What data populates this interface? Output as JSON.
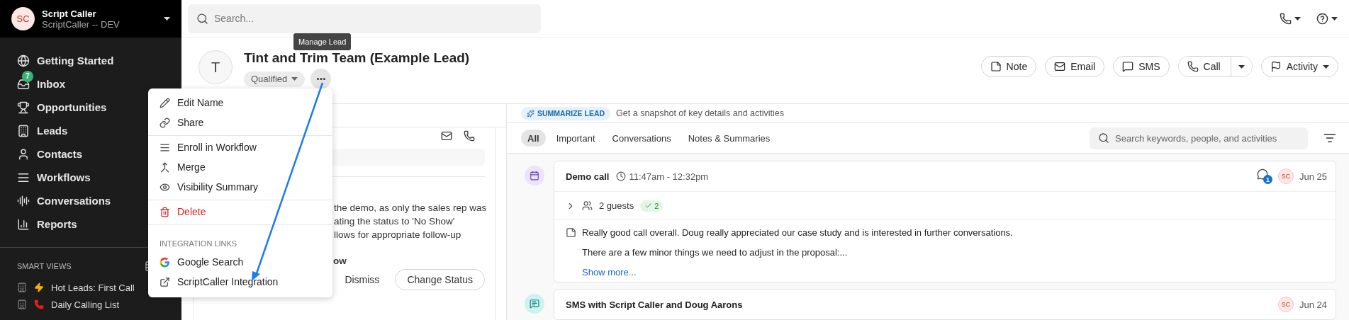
{
  "sidebar": {
    "account": {
      "initials": "SC",
      "name": "Script Caller",
      "subtitle": "ScriptCaller -- DEV"
    },
    "nav": [
      {
        "label": "Getting Started",
        "selected": false
      },
      {
        "label": "Inbox",
        "badge": "7",
        "selected": false
      },
      {
        "label": "Opportunities",
        "selected": false
      },
      {
        "label": "Leads",
        "selected": false
      },
      {
        "label": "Contacts",
        "selected": false
      },
      {
        "label": "Workflows",
        "selected": false
      },
      {
        "label": "Conversations",
        "selected": false
      },
      {
        "label": "Reports",
        "selected": false
      }
    ],
    "smart_views": {
      "title": "SMART VIEWS",
      "items": [
        {
          "label": "Hot Leads: First Call"
        },
        {
          "label": "Daily Calling List"
        }
      ]
    }
  },
  "topbar": {
    "search": {
      "placeholder": "Search..."
    }
  },
  "lead": {
    "avatar": "T",
    "name": "Tint and Trim Team (Example Lead)",
    "status": "Qualified",
    "tooltip": "Manage Lead",
    "actions": [
      {
        "label": "Note",
        "kind": "plain"
      },
      {
        "label": "Email",
        "kind": "plain"
      },
      {
        "label": "SMS",
        "kind": "plain"
      },
      {
        "label": "Call",
        "kind": "split"
      },
      {
        "label": "Activity",
        "kind": "dropdown"
      }
    ]
  },
  "menu": {
    "groups": [
      {
        "items": [
          {
            "label": "Edit Name",
            "danger": false
          },
          {
            "label": "Share",
            "danger": false
          }
        ]
      },
      {
        "items": [
          {
            "label": "Enroll in Workflow",
            "danger": false
          },
          {
            "label": "Merge",
            "danger": false
          },
          {
            "label": "Visibility Summary",
            "danger": false
          }
        ]
      },
      {
        "items": [
          {
            "label": "Delete",
            "danger": true
          }
        ]
      },
      {
        "title": "INTEGRATION LINKS",
        "items": [
          {
            "label": "Google Search",
            "danger": false
          },
          {
            "label": "ScriptCaller Integration",
            "danger": false
          }
        ]
      }
    ]
  },
  "left_panel": {
    "lines": [
      "the demo, as only the sales rep was",
      "ating the status to 'No Show'",
      "llows for appropriate follow-up"
    ],
    "footer_text": "ow",
    "dismiss": "Dismiss",
    "change_status": "Change Status"
  },
  "summary": {
    "button": "SUMMARIZE LEAD",
    "hint": "Get a snapshot of key details and activities"
  },
  "filters": {
    "tabs": [
      {
        "label": "All",
        "selected": true
      },
      {
        "label": "Important",
        "selected": false
      },
      {
        "label": "Conversations",
        "selected": false
      },
      {
        "label": "Notes & Summaries",
        "selected": false
      }
    ],
    "search": {
      "placeholder": "Search keywords, people, and activities"
    }
  },
  "timeline": [
    {
      "kind": "meeting",
      "title": "Demo call",
      "time": "11:47am - 12:32pm",
      "comments": "1",
      "user": "SC",
      "date": "Jun 25",
      "guests": {
        "label": "2 guests",
        "accepted": "2",
        "expanded": false
      },
      "note": [
        "Really good call overall. Doug really appreciated our case study and is interested in further conversations.",
        "There are a few minor things we need to adjust in the proposal:..."
      ],
      "more": "Show more..."
    },
    {
      "kind": "sms",
      "title": "SMS with Script Caller and Doug Aarons",
      "user": "SC",
      "date": "Jun 24"
    }
  ]
}
